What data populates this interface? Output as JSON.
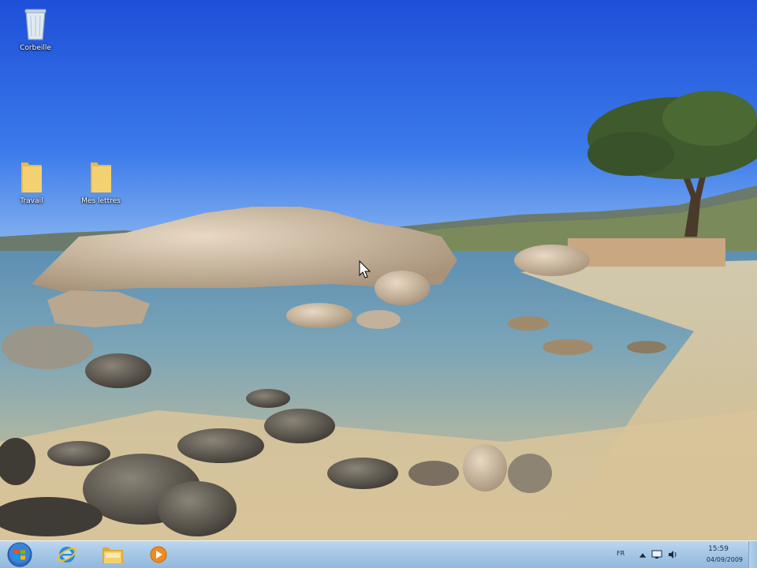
{
  "desktop": {
    "icons": [
      {
        "label": "Corbeille",
        "icon": "recycle-bin-icon"
      },
      {
        "label": "Travail",
        "icon": "folder-icon"
      },
      {
        "label": "Mes lettres",
        "icon": "folder-icon"
      }
    ]
  },
  "taskbar": {
    "start_icon": "windows-logo-icon",
    "pinned": [
      {
        "icon": "internet-explorer-icon"
      },
      {
        "icon": "windows-explorer-folder-icon"
      },
      {
        "icon": "media-player-icon"
      }
    ],
    "tray": {
      "language": "FR",
      "time": "15:59",
      "date": "04/09/2009"
    }
  }
}
